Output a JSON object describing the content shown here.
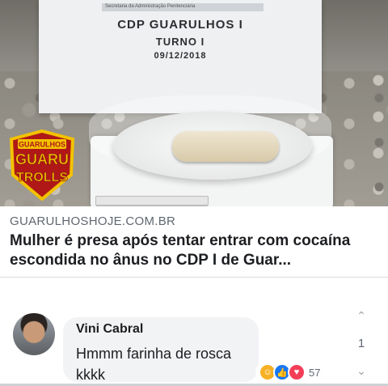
{
  "photo": {
    "sign_header_small": "Secretaria da Administração Penitenciária",
    "sign_line_1": "CDP GUARULHOS I",
    "sign_line_2": "TURNO I",
    "sign_line_3": "09/12/2018",
    "watermark_top": "GUARULHOS",
    "watermark_mid": "GUARU",
    "watermark_bottom": "TROLLS"
  },
  "article": {
    "domain": "GUARULHOSHOJE.COM.BR",
    "headline": "Mulher é presa após tentar entrar com cocaína escondida no ânus no CDP I de Guar..."
  },
  "comment": {
    "author": "Vini Cabral",
    "text": "Hmmm farinha de rosca  kkkk",
    "reaction_count": "57",
    "reaction_icons": [
      "haha-icon",
      "like-icon",
      "love-icon"
    ]
  },
  "scroll": {
    "number": "1"
  },
  "colors": {
    "link_gray": "#606770",
    "bubble_bg": "#f2f3f5",
    "like_blue": "#1877f2",
    "love_red": "#f33e58",
    "haha_yellow": "#f7b125"
  }
}
